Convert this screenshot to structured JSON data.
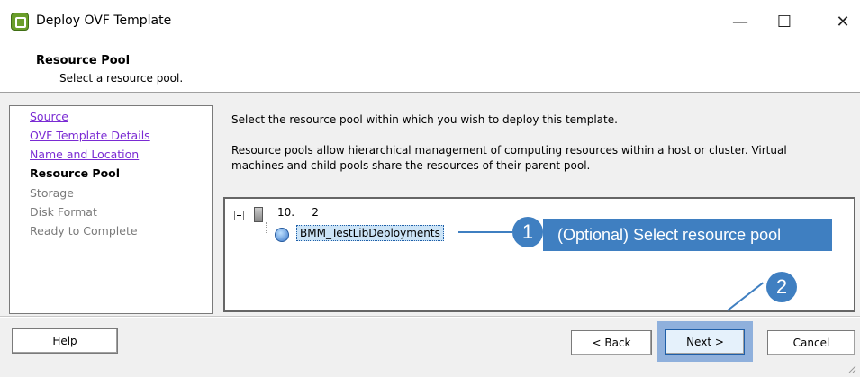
{
  "window": {
    "title": "Deploy OVF Template",
    "minimize": "—",
    "maximize": "☐",
    "close": "✕"
  },
  "header": {
    "title": "Resource Pool",
    "subtitle": "Select a resource pool."
  },
  "nav": {
    "items": [
      {
        "label": "Source",
        "state": "link"
      },
      {
        "label": "OVF Template Details",
        "state": "link"
      },
      {
        "label": "Name and Location",
        "state": "link"
      },
      {
        "label": "Resource Pool",
        "state": "current"
      },
      {
        "label": "Storage",
        "state": "disabled"
      },
      {
        "label": "Disk Format",
        "state": "disabled"
      },
      {
        "label": "Ready to Complete",
        "state": "disabled"
      }
    ]
  },
  "content": {
    "instruction": "Select the resource pool within which you wish to deploy this template.",
    "description_line1": "Resource pools allow hierarchical management of computing resources within a host or cluster. Virtual",
    "description_line2": "machines and child pools share the resources of their parent pool."
  },
  "tree": {
    "host": "10.        2",
    "pool": "BMM_TestLibDeployments"
  },
  "annotations": {
    "step1_number": "1",
    "step1_text": "(Optional) Select resource pool",
    "step2_number": "2",
    "accent": "#3f7fc1"
  },
  "footer": {
    "help": "Help",
    "back": "< Back",
    "next": "Next >",
    "cancel": "Cancel"
  }
}
